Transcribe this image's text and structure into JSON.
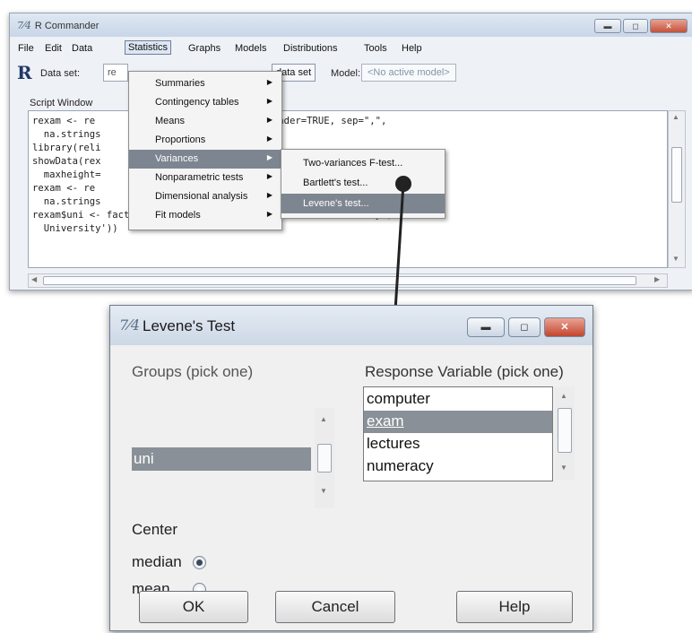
{
  "rcmdr": {
    "title": "R Commander",
    "menu": [
      "File",
      "Edit",
      "Data",
      "Statistics",
      "Graphs",
      "Models",
      "Distributions",
      "Tools",
      "Help"
    ],
    "toolbar": {
      "r_logo": "R",
      "dataset_label": "Data set:",
      "dataset_value": "re",
      "edit_data_button": "data set",
      "model_label": "Model:",
      "model_value": "<No active model>"
    },
    "script_window_label": "Script Window",
    "script_lines": [
      "rexam <- re            mages/RExam.dat\", header=TRUE, sep=\",\",",
      "  na.strings",
      "library(reli",
      "showData(rex                                  'logFont'), maxwidth=80,",
      "  maxheight=",
      "rexam <- re                              , header=TRUE, sep=\"\\t\",",
      "  na.strings                   p.white=TRUE)",
      "rexam$uni <- factor(rexam$uni, labels=c('Duncetown University','Sussex",
      "  University'))"
    ]
  },
  "statistics_menu": [
    {
      "label": "Summaries",
      "arrow": "▶"
    },
    {
      "label": "Contingency tables",
      "arrow": "▶"
    },
    {
      "label": "Means",
      "arrow": "▶"
    },
    {
      "label": "Proportions",
      "arrow": "▶"
    },
    {
      "label": "Variances",
      "arrow": "▶"
    },
    {
      "label": "Nonparametric tests",
      "arrow": "▶"
    },
    {
      "label": "Dimensional analysis",
      "arrow": "▶"
    },
    {
      "label": "Fit models",
      "arrow": "▶"
    }
  ],
  "variances_menu": [
    "Two-variances F-test...",
    "Bartlett's test...",
    "Levene's test..."
  ],
  "dialog": {
    "title": "Levene's Test",
    "groups_label": "Groups (pick one)",
    "groups": [
      "uni"
    ],
    "response_label": "Response Variable (pick one)",
    "response_items": [
      "computer",
      "exam",
      "lectures",
      "numeracy"
    ],
    "center_label": "Center",
    "center_options": [
      "median",
      "mean"
    ],
    "center_selected": "median",
    "buttons": {
      "ok": "OK",
      "cancel": "Cancel",
      "help": "Help"
    }
  },
  "window_controls": {
    "minimize": "▬",
    "maximize": "◻",
    "close": "✕"
  },
  "scroll_arrows": {
    "up": "▲",
    "down": "▼",
    "left": "◀",
    "right": "▶"
  }
}
